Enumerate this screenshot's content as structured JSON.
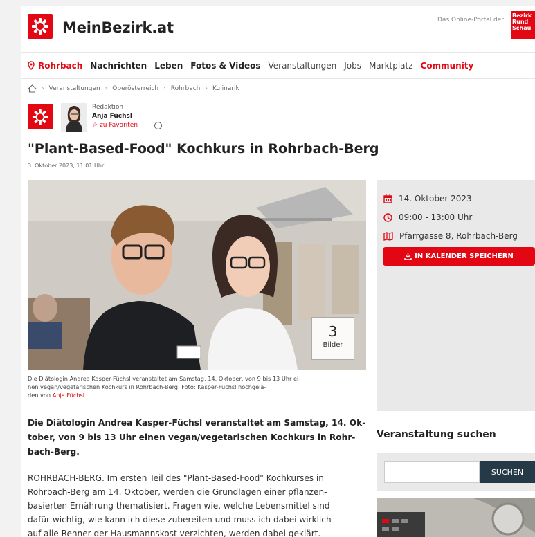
{
  "header": {
    "logo_text": "MeinBezirk.at",
    "portal_text": "Das Online-Portal der",
    "badge_lines": [
      "Bezirk",
      "Rund",
      "Schau"
    ]
  },
  "nav": {
    "location": "Rohrbach",
    "items": [
      "Nachrichten",
      "Leben",
      "Fotos & Videos",
      "Veranstaltungen",
      "Jobs",
      "Marktplatz",
      "Community"
    ]
  },
  "breadcrumb": [
    "Veranstaltungen",
    "Oberösterreich",
    "Rohrbach",
    "Kulinarik"
  ],
  "author": {
    "role": "Redaktion",
    "name": "Anja Füchsl",
    "favorite_label": "zu Favoriten"
  },
  "article": {
    "title": "\"Plant-Based-Food\" Kochkurs in Rohrbach-Berg",
    "date": "3. Oktober 2023, 11:01 Uhr",
    "image_count": "3",
    "image_count_label": "Bilder",
    "caption_lines": [
      "Die Diätologin Andrea Kasper-Füchsl veranstaltet am Samstag, 14. Oktober, von 9 bis 13 Uhr ei-",
      "nen vegan/vegetarischen Kochkurs in Rohrbach-Berg.      Foto: Kasper-Füchsl      hochgela-"
    ],
    "caption_upload_prefix": "den von",
    "caption_uploader": "Anja Füchsl",
    "lead_lines": [
      "Die Diätologin Andrea Kasper-Füchsl veranstaltet am Samstag, 14. Ok-",
      "tober, von 9 bis 13 Uhr einen vegan/vegetarischen Kochkurs in Rohr-",
      "bach-Berg."
    ],
    "body_lines": [
      "ROHRBACH-BERG. Im ersten Teil des \"Plant-Based-Food\" Kochkurses in",
      "Rohrbach-Berg am 14. Oktober,  werden die Grundlagen einer pflanzen-",
      "basierten Ernährung thematisiert. Fragen wie, welche Lebensmittel sind",
      "dafür wichtig, wie kann ich diese zubereiten und muss ich dabei wirklich",
      "auf alle Renner der Hausmannskost verzichten, werden dabei geklärt."
    ]
  },
  "event": {
    "date": "14. Oktober 2023",
    "time": "09:00 - 13:00 Uhr",
    "location": "Pfarrgasse 8, Rohrbach-Berg",
    "calendar_button": "IN KALENDER SPEICHERN"
  },
  "search": {
    "title": "Veranstaltung suchen",
    "placeholder": "",
    "button": "SUCHEN"
  },
  "colors": {
    "brand_red": "#e30613",
    "search_button": "#253a46",
    "sidebar_bg": "#e9e9e9"
  }
}
